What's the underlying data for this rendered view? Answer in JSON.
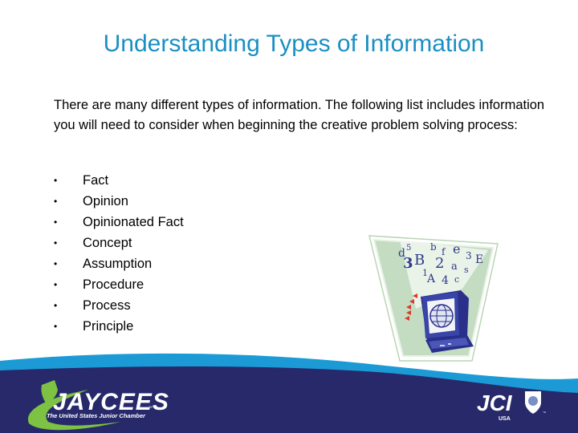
{
  "slide": {
    "title": "Understanding Types of Information",
    "intro": "There are many different types of information. The following list includes information you will need to consider when beginning the creative problem solving process:",
    "bullet_glyph": "•",
    "bullets": [
      "Fact",
      "Opinion",
      "Opinionated Fact",
      "Concept",
      "Assumption",
      "Procedure",
      "Process",
      "Principle"
    ]
  },
  "clipart": {
    "description": "computer-with-floating-characters",
    "characters": [
      "d",
      "5",
      "b",
      "f",
      "e",
      "3",
      "E",
      "3",
      "B",
      "2",
      "a",
      "s",
      "1",
      "A",
      "4",
      "c"
    ]
  },
  "footer": {
    "jaycees_logo_text": "JAYCEES",
    "jaycees_tagline": "The United States Junior Chamber",
    "jci_logo_text": "JCI",
    "jci_subtext": "USA",
    "trademark": "™",
    "colors": {
      "navy": "#27296b",
      "wave_blue": "#1b9ad6",
      "green": "#7dc242",
      "title_blue": "#1a8fc4"
    }
  }
}
